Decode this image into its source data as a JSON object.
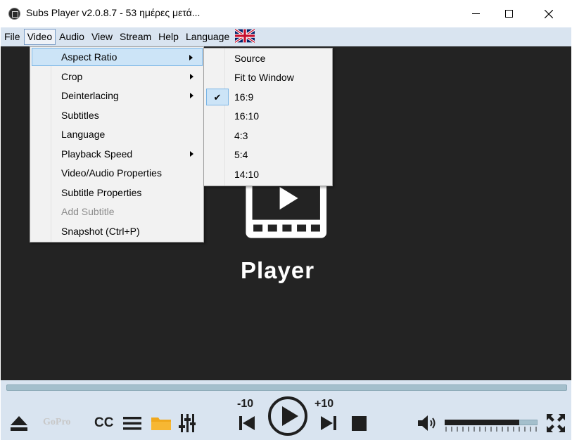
{
  "window": {
    "title": "Subs Player v2.0.8.7 - 53 ημέρες μετά..."
  },
  "menubar": {
    "items": [
      {
        "label": "File"
      },
      {
        "label": "Video",
        "active": true
      },
      {
        "label": "Audio"
      },
      {
        "label": "View"
      },
      {
        "label": "Stream"
      },
      {
        "label": "Help"
      },
      {
        "label": "Language"
      }
    ],
    "flag_icon": "uk-flag-icon"
  },
  "video_menu": {
    "items": [
      {
        "label": "Aspect Ratio",
        "submenu": true,
        "highlighted": true
      },
      {
        "label": "Crop",
        "submenu": true
      },
      {
        "label": "Deinterlacing",
        "submenu": true
      },
      {
        "label": "Subtitles"
      },
      {
        "label": "Language"
      },
      {
        "label": "Playback Speed",
        "submenu": true
      },
      {
        "label": "Video/Audio Properties"
      },
      {
        "label": "Subtitle Properties"
      },
      {
        "label": "Add Subtitle",
        "disabled": true
      },
      {
        "label": "Snapshot (Ctrl+P)"
      }
    ]
  },
  "aspect_menu": {
    "items": [
      {
        "label": "Source"
      },
      {
        "label": "Fit to Window"
      },
      {
        "label": "16:9",
        "checked": true
      },
      {
        "label": "16:10"
      },
      {
        "label": "4:3"
      },
      {
        "label": "5:4"
      },
      {
        "label": "14:10"
      }
    ],
    "check_glyph": "✔"
  },
  "video": {
    "logo_text": "Player"
  },
  "controls": {
    "gopro_label": "GoPro",
    "cc_label": "CC",
    "skip_back_label": "-10",
    "skip_forward_label": "+10",
    "volume_level": 0.8
  },
  "colors": {
    "menubar_bg": "#d9e4f0",
    "video_bg": "#232323",
    "highlight": "#cce4f7",
    "highlight_border": "#7ab5e6",
    "folder": "#f0a81c"
  }
}
